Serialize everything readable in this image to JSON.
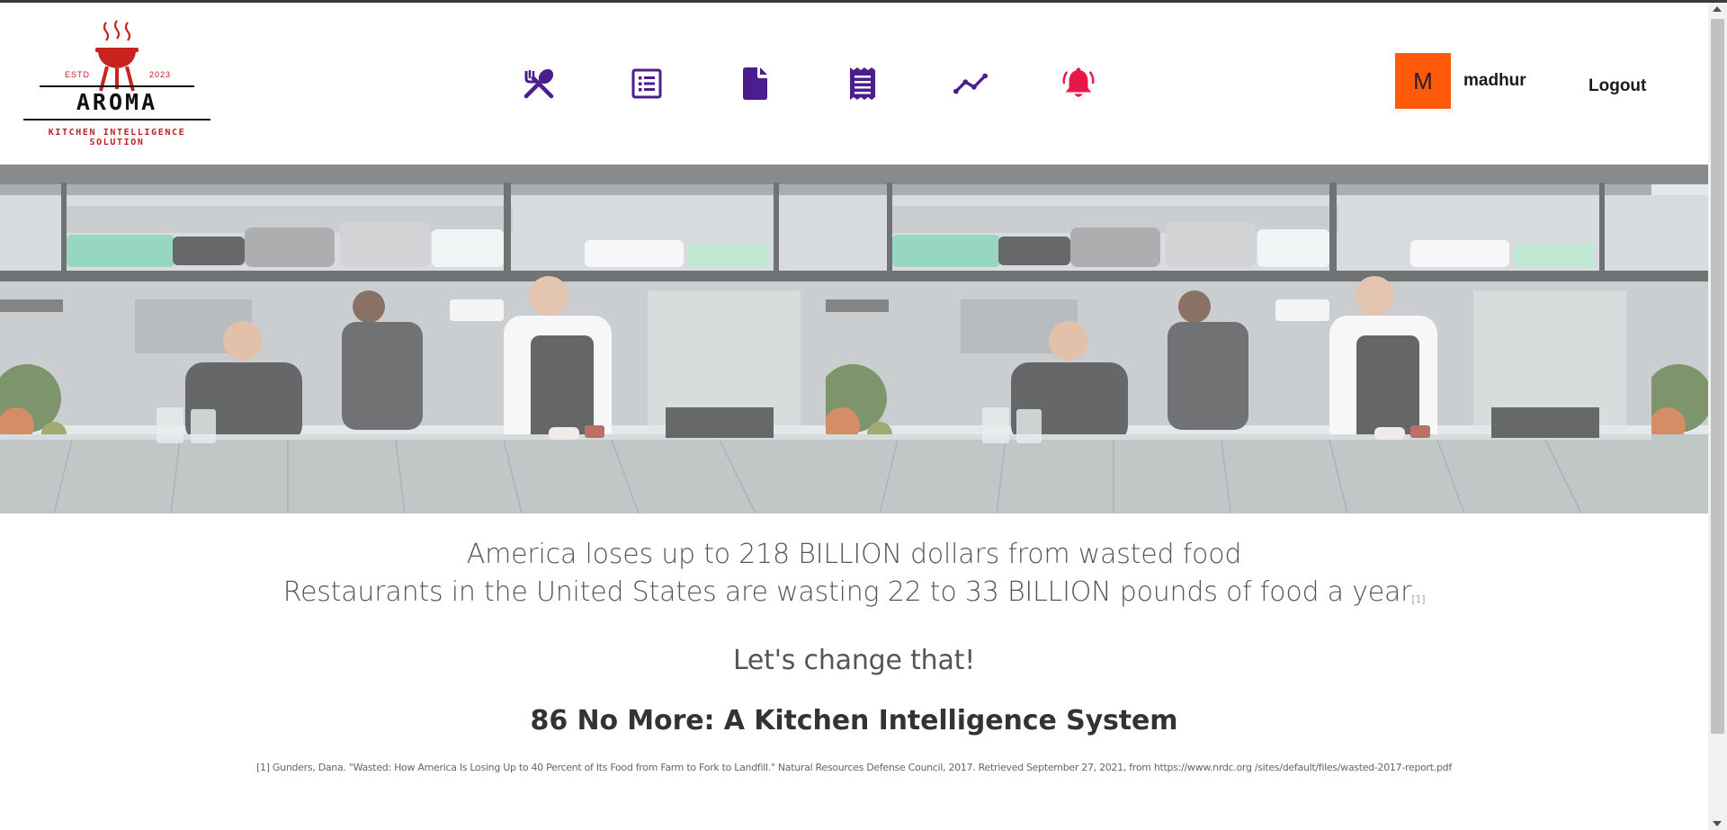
{
  "logo": {
    "estd": "ESTD",
    "year": "2023",
    "brand": "AROMA",
    "tagline": "KITCHEN INTELLIGENCE SOLUTION"
  },
  "nav": {
    "icons": [
      "utensils-icon",
      "list-icon",
      "document-icon",
      "receipt-icon",
      "trend-line-icon",
      "bell-icon"
    ],
    "icon_color": "#4b1d8f",
    "alert_color": "#e8174a"
  },
  "user": {
    "avatar_initial": "M",
    "avatar_color": "#ff5a0a",
    "name": "madhur",
    "logout": "Logout"
  },
  "hero": {
    "image": "kitchen-chefs-photo"
  },
  "content": {
    "stat1": "America loses up to 218 BILLION dollars from wasted food",
    "stat2": "Restaurants in the United States are wasting 22 to 33 BILLION pounds of food a year",
    "stat2_ref": "[1]",
    "cta": "Let's change that!",
    "system_title": "86 No More: A Kitchen Intelligence System",
    "citation": "[1] Gunders, Dana. \"Wasted: How America Is Losing Up to 40 Percent of Its Food from Farm to Fork to Landfill.\" Natural Resources Defense Council, 2017. Retrieved September 27, 2021, from https://www.nrdc.org /sites/default/files/wasted-2017-report.pdf"
  }
}
